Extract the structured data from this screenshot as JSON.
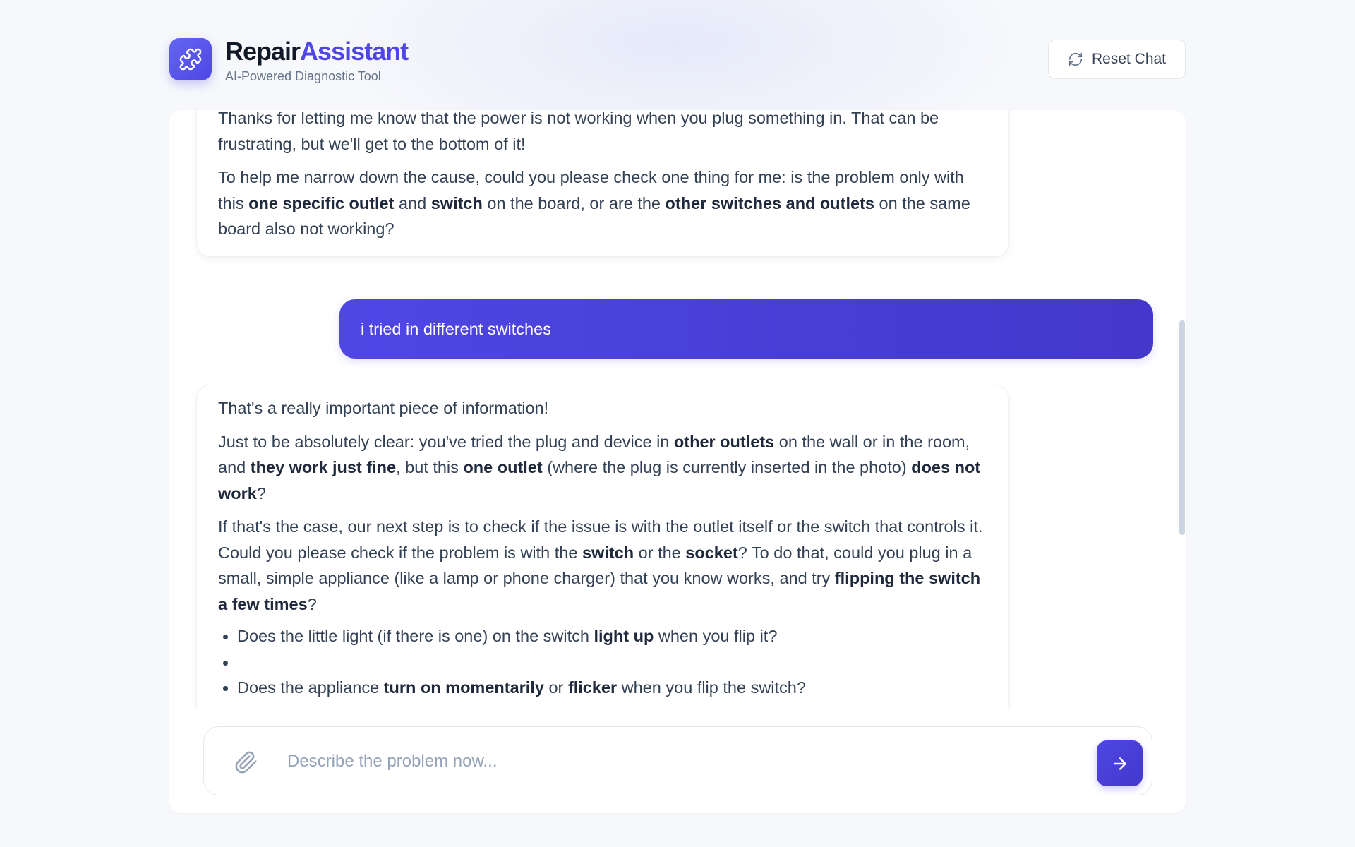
{
  "header": {
    "brand_part1": "Repair",
    "brand_part2": "Assistant",
    "tagline": "AI-Powered Diagnostic Tool",
    "reset_label": "Reset Chat",
    "logo_icon": "puzzle-icon",
    "reset_icon": "refresh-icon"
  },
  "messages": {
    "m1": {
      "p1": "Thanks for letting me know that the power is not working when you plug something in. That can be frustrating, but we'll get to the bottom of it!",
      "p2_a": "To help me narrow down the cause, could you please check one thing for me: is the problem only with this ",
      "p2_b": "one specific outlet",
      "p2_c": " and ",
      "p2_d": "switch",
      "p2_e": " on the board, or are the ",
      "p2_f": "other switches and outlets",
      "p2_g": " on the same board also not working?"
    },
    "user1": "i tried in different switches",
    "m2": {
      "p1": "That's a really important piece of information!",
      "p2_a": "Just to be absolutely clear: you've tried the plug and device in ",
      "p2_b": "other outlets",
      "p2_c": " on the wall or in the room, and ",
      "p2_d": "they work just fine",
      "p2_e": ", but this ",
      "p2_f": "one outlet",
      "p2_g": " (where the plug is currently inserted in the photo) ",
      "p2_h": "does not work",
      "p2_i": "?",
      "p3_a": "If that's the case, our next step is to check if the issue is with the outlet itself or the switch that controls it. Could you please check if the problem is with the ",
      "p3_b": "switch",
      "p3_c": " or the ",
      "p3_d": "socket",
      "p3_e": "? To do that, could you plug in a small, simple appliance (like a lamp or phone charger) that you know works, and try ",
      "p3_f": "flipping the switch a few times",
      "p3_g": "?",
      "li1_a": "Does the little light (if there is one) on the switch ",
      "li1_b": "light up",
      "li1_c": " when you flip it?",
      "li3_a": "Does the appliance ",
      "li3_b": "turn on momentarily",
      "li3_c": " or ",
      "li3_d": "flicker",
      "li3_e": " when you flip the switch?"
    }
  },
  "composer": {
    "placeholder": "Describe the problem now...",
    "value": "",
    "attach_icon": "paperclip-icon",
    "send_icon": "arrow-right-icon"
  },
  "colors": {
    "accent": "#4f46e5",
    "accent_dark": "#4338ca",
    "text": "#334155",
    "muted": "#64748b",
    "placeholder": "#94a3b8"
  }
}
